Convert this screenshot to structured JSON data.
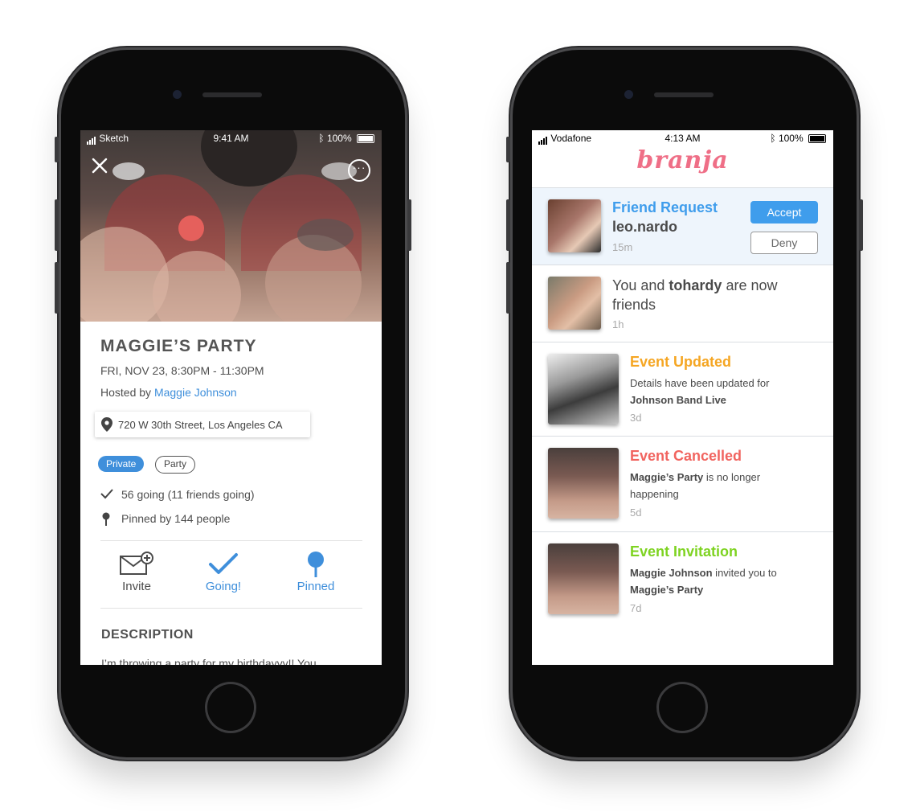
{
  "left_phone": {
    "status_bar": {
      "carrier": "Sketch",
      "time": "9:41 AM",
      "battery": "100%"
    },
    "event": {
      "title": "MAGGIE’S PARTY",
      "date": "FRI, NOV 23, 8:30PM - 11:30PM",
      "hosted_by_label": "Hosted by",
      "host_name": "Maggie Johnson",
      "address": "720 W 30th Street, Los Angeles CA",
      "tags": [
        "Private",
        "Party"
      ],
      "going": "56 going (11 friends going)",
      "pinned": "Pinned by 144 people"
    },
    "actions": {
      "invite": "Invite",
      "going": "Going!",
      "pinned": "Pinned"
    },
    "description": {
      "heading": "DESCRIPTION",
      "text": "I’m throwing a party for my birthdayyy!! You"
    },
    "icons": [
      "close-icon",
      "more-icon",
      "map-pin-icon",
      "check-icon",
      "pin-icon",
      "invite-envelope-icon"
    ],
    "colors": {
      "accent": "#3f8fdb"
    }
  },
  "right_phone": {
    "status_bar": {
      "carrier": "Vodafone",
      "time": "4:13 AM",
      "battery": "100%"
    },
    "logo_text": "branja",
    "notifications": [
      {
        "title": "Friend Request",
        "user": "leo.nardo",
        "time": "15m",
        "accept": "Accept",
        "deny": "Deny",
        "color": "#3f9dec"
      },
      {
        "text_prefix": "You and ",
        "user": "tohardy",
        "text_suffix": " are now friends",
        "time": "1h"
      },
      {
        "title": "Event Updated",
        "text": "Details have been updated for",
        "subject": "Johnson Band Live",
        "time": "3d",
        "color": "#f5a623"
      },
      {
        "title": "Event Cancelled",
        "subject": "Maggie’s Party",
        "text": " is no longer happening",
        "time": "5d",
        "color": "#f1645f"
      },
      {
        "title": "Event Invitation",
        "actor": "Maggie Johnson",
        "text": " invited you to",
        "subject": "Maggie’s Party",
        "time": "7d",
        "color": "#7ed321"
      }
    ]
  }
}
